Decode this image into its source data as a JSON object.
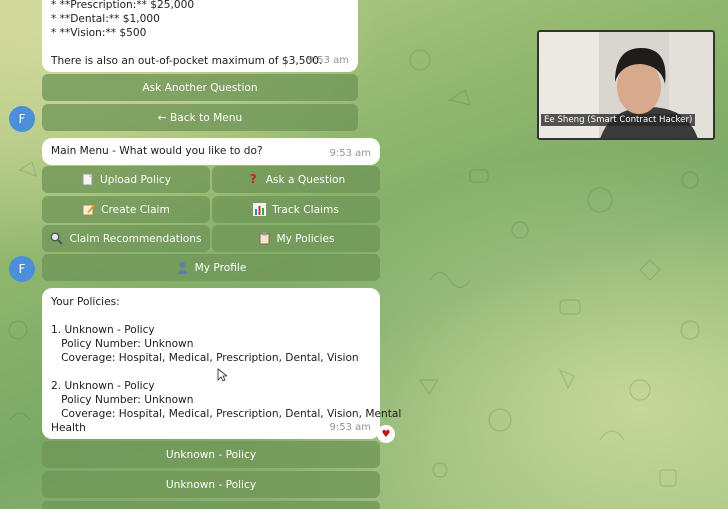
{
  "chat": {
    "avatar_letter": "F",
    "top_message": {
      "lines": [
        "* **Prescription:** $25,000",
        "* **Dental:** $1,000",
        "* **Vision:** $500",
        "",
        "There is also an out-of-pocket maximum of $3,500."
      ],
      "time": "9:53 am"
    },
    "reply_buttons_1": {
      "ask_another": "Ask Another Question",
      "back_menu": "← Back to Menu"
    },
    "menu_message": {
      "text": "Main Menu - What would you like to do?",
      "time": "9:53 am"
    },
    "menu_buttons": {
      "upload": "Upload Policy",
      "ask": "Ask a Question",
      "create_claim": "Create Claim",
      "track_claims": "Track Claims",
      "recommendations": "Claim Recommendations",
      "my_policies": "My Policies",
      "my_profile": "My Profile"
    },
    "policies_message": {
      "header": "Your Policies:",
      "p1_title": "1. Unknown - Policy",
      "p1_number": "   Policy Number: Unknown",
      "p1_coverage": "   Coverage: Hospital, Medical, Prescription, Dental, Vision",
      "p2_title": "2. Unknown - Policy",
      "p2_number": "   Policy Number: Unknown",
      "p2_coverage_a": "   Coverage: Hospital, Medical, Prescription, Dental, Vision, Mental",
      "p2_coverage_b": "Health",
      "time": "9:53 am",
      "reaction": "heart"
    },
    "policy_buttons": [
      "Unknown - Policy",
      "Unknown - Policy"
    ]
  },
  "video": {
    "participant_name": "Ee Sheng (Smart Contract Hacker)"
  },
  "colors": {
    "button_bg": "#70965899",
    "avatar_bg": "#4a8fd8",
    "bubble_bg": "#ffffff"
  }
}
